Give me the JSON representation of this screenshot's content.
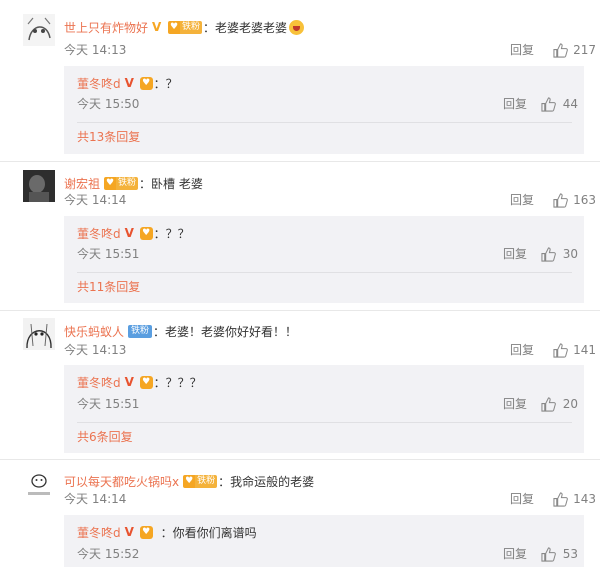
{
  "comments": [
    {
      "username": "世上只有炸物好",
      "fan_badge": "铁粉",
      "content": "：老婆老婆老婆",
      "time": "今天 14:13",
      "reply_label": "回复",
      "likes": "217",
      "sub": {
        "username": "董冬咚d",
        "content": "：？",
        "time": "今天 15:50",
        "reply_label": "回复",
        "likes": "44",
        "more": "共13条回复"
      }
    },
    {
      "username": "谢宏祖",
      "fan_badge": "铁粉",
      "content": "：卧槽 老婆",
      "time": "今天 14:14",
      "reply_label": "回复",
      "likes": "163",
      "sub": {
        "username": "董冬咚d",
        "content": "：？？",
        "time": "今天 15:51",
        "reply_label": "回复",
        "likes": "30",
        "more": "共11条回复"
      }
    },
    {
      "username": "快乐蚂蚁人",
      "fan_badge": "铁粉",
      "content": "：老婆！老婆你好好看！！",
      "time": "今天 14:13",
      "reply_label": "回复",
      "likes": "141",
      "sub": {
        "username": "董冬咚d",
        "content": "：？？？",
        "time": "今天 15:51",
        "reply_label": "回复",
        "likes": "20",
        "more": "共6条回复"
      }
    },
    {
      "username": "可以每天都吃火锅吗x",
      "fan_badge": "铁粉",
      "content": "：我命运般的老婆",
      "time": "今天 14:14",
      "reply_label": "回复",
      "likes": "143",
      "sub": {
        "username": "董冬咚d",
        "content": "：你看你们离谱吗",
        "time": "今天 15:52",
        "reply_label": "回复",
        "likes": "53"
      }
    }
  ],
  "colors": {
    "username": "#eb7350",
    "meta": "#808080",
    "sub_bg": "#f2f2f5"
  },
  "icons": [
    "thumbs-up-icon",
    "verified-v-icon",
    "heart-badge-icon",
    "laugh-emoji-icon"
  ]
}
